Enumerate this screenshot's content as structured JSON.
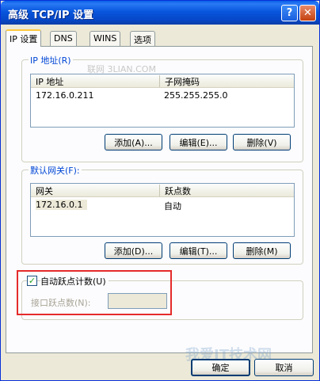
{
  "window": {
    "title": "高级 TCP/IP 设置",
    "help_label": "?",
    "close_label": "✕"
  },
  "tabs": [
    {
      "label": "IP 设置",
      "active": true
    },
    {
      "label": "DNS",
      "active": false
    },
    {
      "label": "WINS",
      "active": false
    },
    {
      "label": "选项",
      "active": false
    }
  ],
  "ip_group": {
    "label": "IP 地址(R)",
    "columns": [
      "IP 地址",
      "子网掩码"
    ],
    "rows": [
      [
        "172.16.0.211",
        "255.255.255.0"
      ]
    ],
    "buttons": {
      "add": "添加(A)...",
      "edit": "编辑(E)...",
      "delete": "删除(V)"
    }
  },
  "gateway_group": {
    "label": "默认网关(F):",
    "columns": [
      "网关",
      "跃点数"
    ],
    "rows": [
      [
        "172.16.0.1",
        "自动"
      ]
    ],
    "buttons": {
      "add": "添加(D)...",
      "edit": "编辑(T)...",
      "delete": "删除(M)"
    }
  },
  "metric": {
    "checkbox_label": "自动跃点计数(U)",
    "checked": true,
    "interface_label": "接口跃点数(N):",
    "interface_value": ""
  },
  "footer": {
    "ok": "确定",
    "cancel": "取消"
  },
  "watermarks": {
    "top": "联网 3LIAN.COM",
    "bottom": "我爱IT技术网"
  },
  "colors": {
    "accent": "#0046d5",
    "highlight_box": "#e52b2b"
  }
}
